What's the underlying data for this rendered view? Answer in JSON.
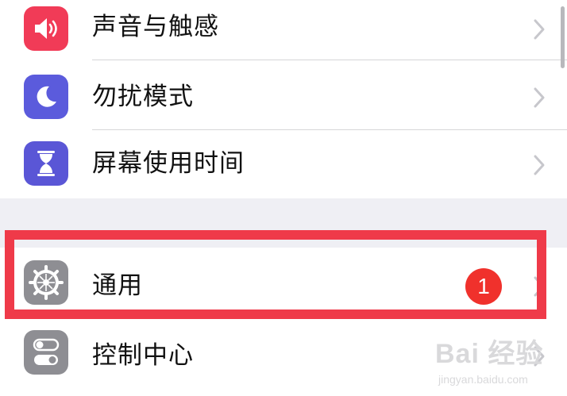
{
  "settings": {
    "group1": [
      {
        "id": "sounds",
        "label": "声音与触感",
        "icon": "speaker-wave-icon",
        "color": "#f13b57"
      },
      {
        "id": "dnd",
        "label": "勿扰模式",
        "icon": "moon-icon",
        "color": "#5b5bdc"
      },
      {
        "id": "screentime",
        "label": "屏幕使用时间",
        "icon": "hourglass-icon",
        "color": "#5a56d6"
      }
    ],
    "group2": [
      {
        "id": "general",
        "label": "通用",
        "icon": "gear-icon",
        "color": "#8e8e93",
        "badge": "1"
      },
      {
        "id": "control",
        "label": "控制中心",
        "icon": "toggles-icon",
        "color": "#8e8e93"
      }
    ]
  },
  "colors": {
    "highlight": "#ef3a49",
    "badge": "#f0312c",
    "group_gap": "#efeff4"
  },
  "watermark": {
    "brand": "Bai 经验",
    "url": "jingyan.baidu.com"
  }
}
